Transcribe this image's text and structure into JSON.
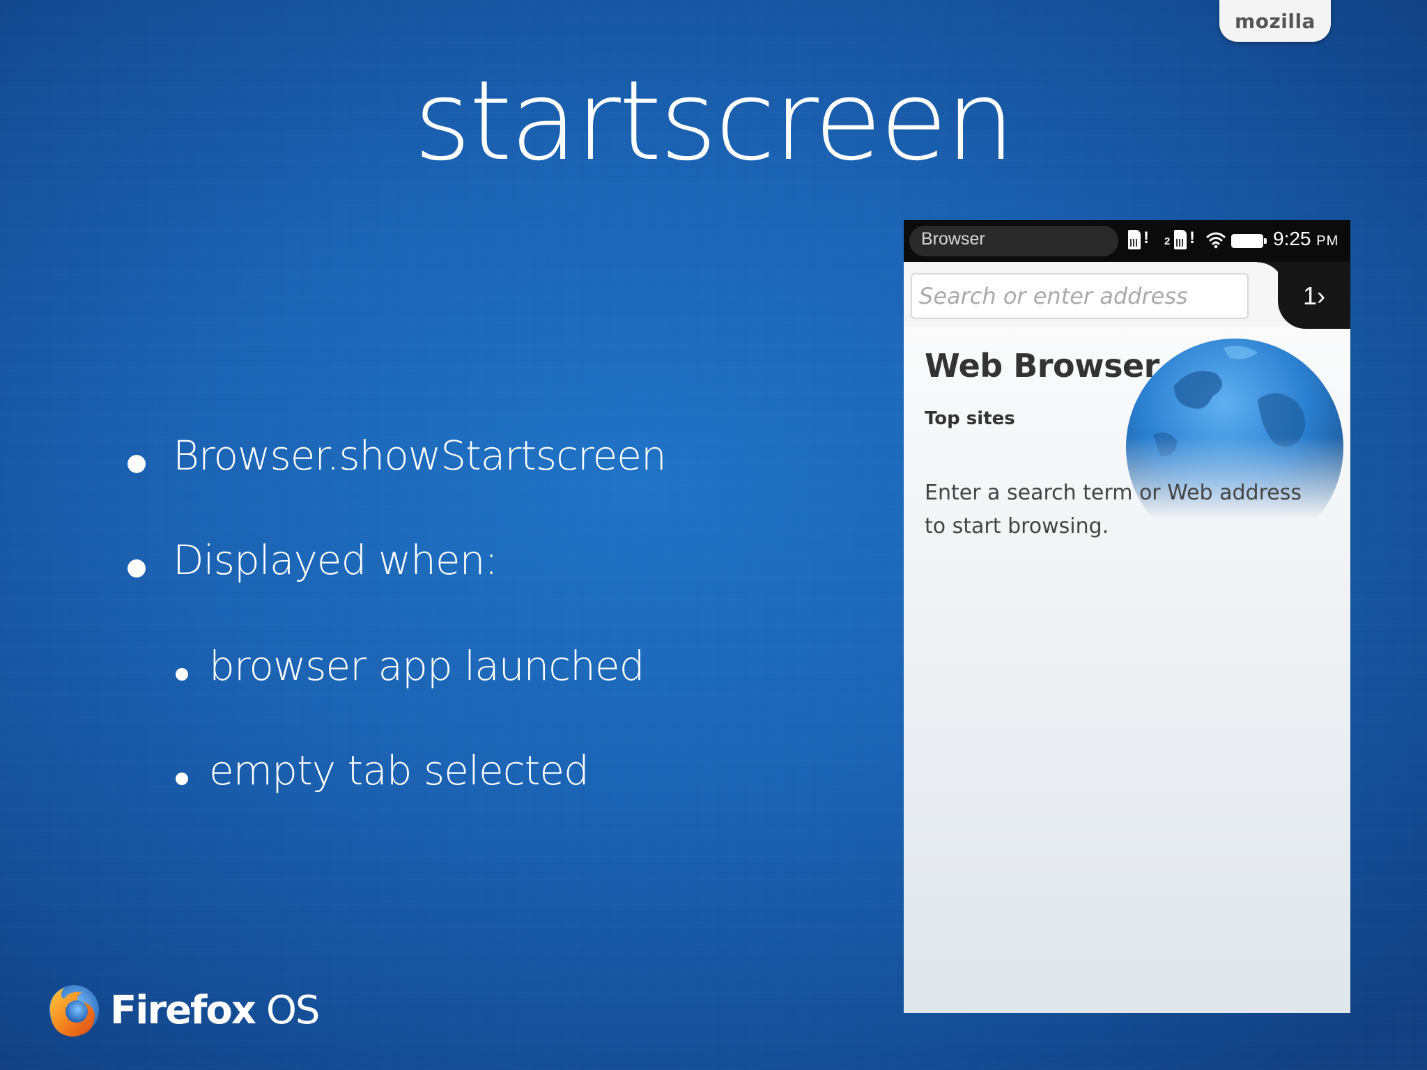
{
  "slide": {
    "title": "startscreen",
    "brand_tab": "mozilla",
    "bullets": [
      "Browser.showStartscreen",
      "Displayed when:"
    ],
    "sub_bullets": [
      "browser app launched",
      "empty tab selected"
    ],
    "logo": {
      "name_bold": "Firefox",
      "name_light": " OS"
    }
  },
  "phone": {
    "statusbar": {
      "app_name": "Browser",
      "sim2_number": "2",
      "time": "9:25",
      "ampm": "PM"
    },
    "urlbar": {
      "placeholder": "Search or enter address",
      "tabs_label": "1›"
    },
    "content": {
      "title": "Web Browser",
      "top_sites": "Top sites",
      "hint": "Enter a search term or Web address to start browsing."
    }
  },
  "colors": {
    "background": "#1a62b4",
    "phone_statusbar": "#0b0b0b",
    "globe": "#2a86d8"
  },
  "icons": [
    "sim-card-icon",
    "no-signal-icon",
    "wifi-icon",
    "battery-icon",
    "globe-icon",
    "firefox-logo-icon"
  ]
}
